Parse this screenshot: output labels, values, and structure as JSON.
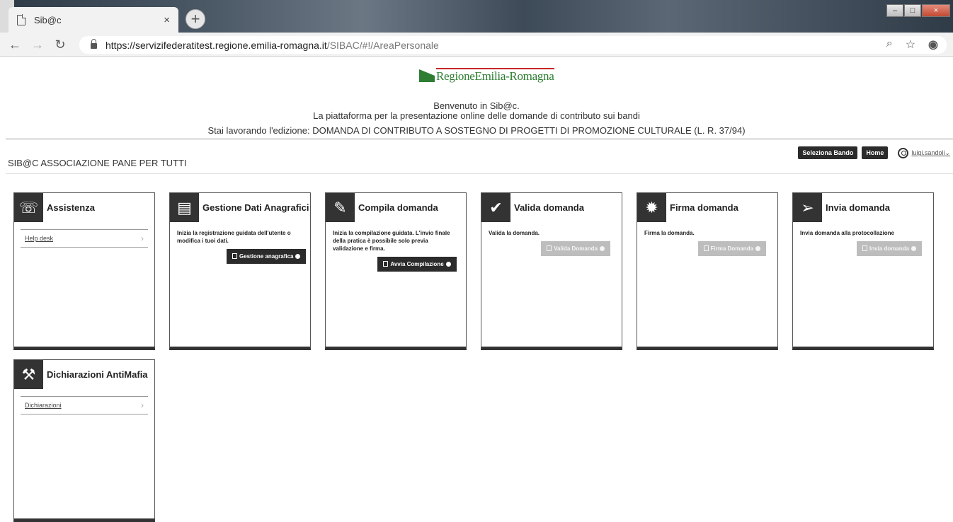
{
  "browser": {
    "tab_title": "Sib@c",
    "tab_close": "×",
    "new_tab": "+",
    "url_host": "https://servizifederatitest.regione.emilia-romagna.it",
    "url_path": "/SIBAC/#!/AreaPersonale"
  },
  "header": {
    "logo_text": "RegioneEmilia-Romagna",
    "welcome_line1": "Benvenuto in Sib@c.",
    "welcome_line2": "La piattaforma per la presentazione online delle domande di contributo sui bandi",
    "edition": "Stai lavorando l'edizione: DOMANDA DI CONTRIBUTO A SOSTEGNO DI PROGETTI DI PROMOZIONE CULTURALE (L. R. 37/94)"
  },
  "toolbar": {
    "org_name": "SIB@C ASSOCIAZIONE PANE PER TUTTI",
    "select_bando": "Seleziona Bando",
    "home": "Home",
    "user": "luigi.sandoli"
  },
  "cards": {
    "assistenza": {
      "title": "Assistenza",
      "link": "Help desk"
    },
    "anagrafici": {
      "title": "Gestione Dati Anagrafici",
      "text": "Inizia la registrazione guidata dell'utente o modifica i tuoi dati.",
      "button": "Gestione anagrafica"
    },
    "compila": {
      "title": "Compila domanda",
      "text": "Inizia la compilazione guidata. L'invio finale della pratica è possibile solo previa validazione e firma.",
      "button": "Avvia Compilazione"
    },
    "valida": {
      "title": "Valida domanda",
      "text": "Valida la domanda.",
      "button": "Valida Domanda"
    },
    "firma": {
      "title": "Firma domanda",
      "text": "Firma la domanda.",
      "button": "Firma Domanda"
    },
    "invia": {
      "title": "Invia domanda",
      "text": "Invia domanda alla protocollazione",
      "button": "Invia domanda"
    },
    "antimafia": {
      "title": "Dichiarazioni AntiMafia",
      "link": "Dichiarazioni"
    }
  },
  "colors": {
    "dark": "#333333",
    "disabled": "#bdbdbd",
    "logo_green": "#2d7d32",
    "logo_red": "#c62828"
  }
}
